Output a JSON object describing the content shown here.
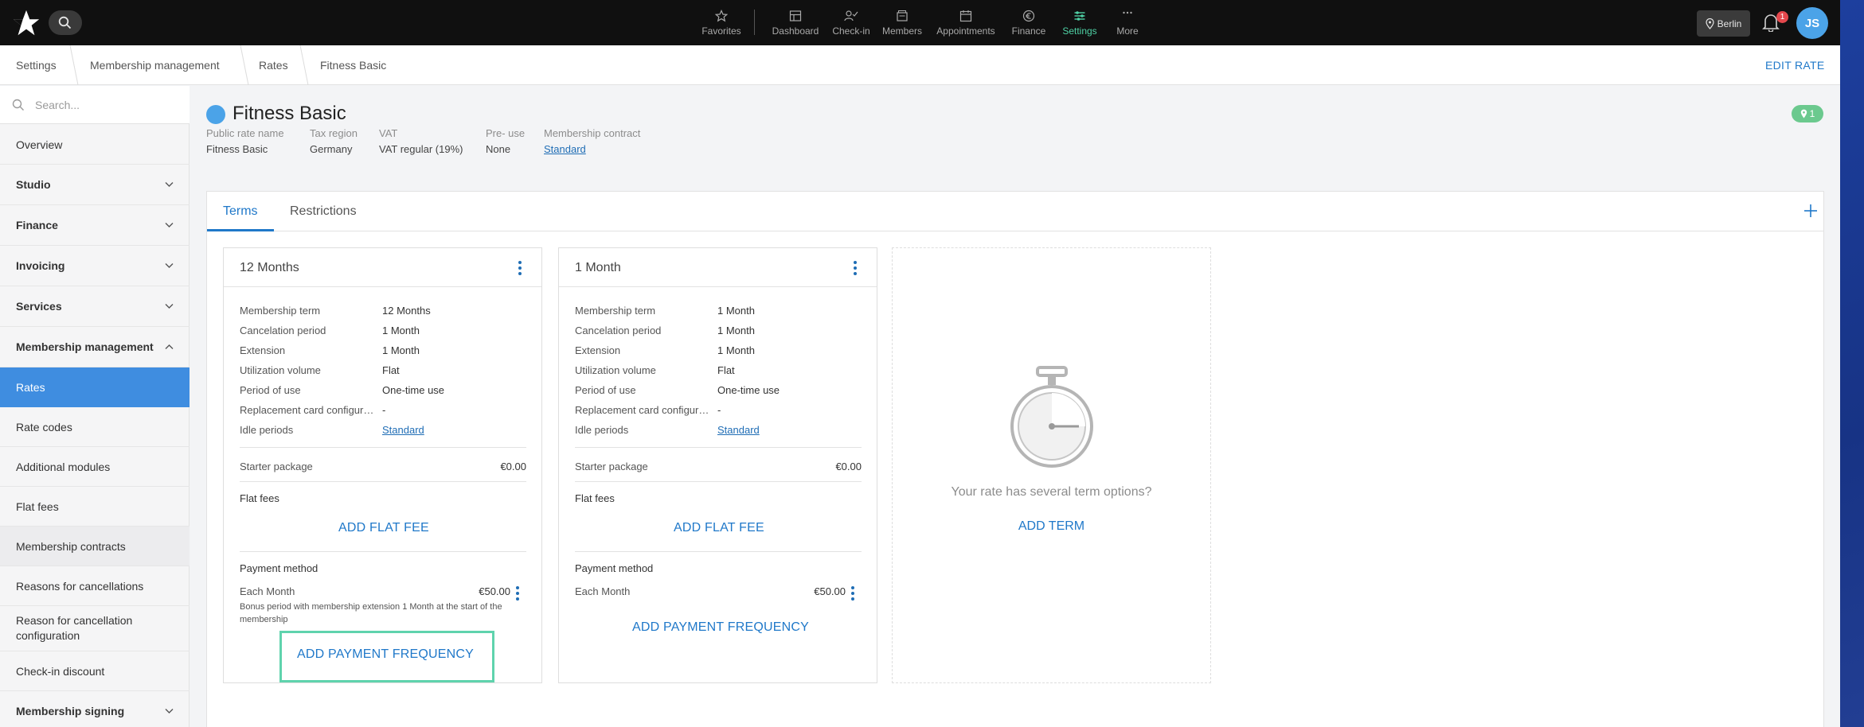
{
  "topbar": {
    "nav": [
      {
        "label": "Favorites",
        "icon": "star-icon"
      },
      {
        "label": "Dashboard",
        "icon": "dashboard-icon"
      },
      {
        "label": "Check-in",
        "icon": "check-in-icon"
      },
      {
        "label": "Members",
        "icon": "members-icon"
      },
      {
        "label": "Appointments",
        "icon": "calendar-icon"
      },
      {
        "label": "Finance",
        "icon": "euro-icon"
      },
      {
        "label": "Settings",
        "icon": "settings-icon",
        "active": true
      },
      {
        "label": "More",
        "icon": "more-icon"
      }
    ],
    "location": "Berlin",
    "notification_count": "1",
    "avatar_initials": "JS",
    "accent": "#4fd1a5"
  },
  "breadcrumb": [
    "Settings",
    "Membership management",
    "Rates",
    "Fitness Basic"
  ],
  "edit_rate": "EDIT RATE",
  "sidebar": {
    "search_placeholder": "Search...",
    "items": [
      {
        "label": "Overview"
      },
      {
        "label": "Studio",
        "section": true
      },
      {
        "label": "Finance",
        "section": true
      },
      {
        "label": "Invoicing",
        "section": true
      },
      {
        "label": "Services",
        "section": true
      },
      {
        "label": "Membership management",
        "section": true,
        "expanded": true
      },
      {
        "label": "Rates",
        "active": true
      },
      {
        "label": "Rate codes"
      },
      {
        "label": "Additional modules"
      },
      {
        "label": "Flat fees"
      },
      {
        "label": "Membership contracts"
      },
      {
        "label": "Reasons for cancellations"
      },
      {
        "label": "Reason for cancellation configuration"
      },
      {
        "label": "Check-in discount"
      },
      {
        "label": "Membership signing",
        "section": true
      }
    ]
  },
  "rate": {
    "title": "Fitness Basic",
    "color": "#4ba3e8",
    "badge_count": "1",
    "meta": [
      {
        "label": "Public rate name",
        "value": "Fitness Basic"
      },
      {
        "label": "Tax region",
        "value": "Germany"
      },
      {
        "label": "VAT",
        "value": "VAT regular (19%)"
      },
      {
        "label": "Pre- use",
        "value": "None"
      },
      {
        "label": "Membership contract",
        "value": "Standard",
        "link": true
      }
    ]
  },
  "tabs": [
    "Terms",
    "Restrictions"
  ],
  "labels": {
    "membership_term": "Membership term",
    "cancelation_period": "Cancelation period",
    "extension": "Extension",
    "utilization_volume": "Utilization volume",
    "period_of_use": "Period of use",
    "replacement_card": "Replacement card configuration",
    "idle_periods": "Idle periods",
    "starter_package": "Starter package",
    "flat_fees": "Flat fees",
    "add_flat_fee": "ADD FLAT FEE",
    "payment_method": "Payment method",
    "add_payment_frequency": "ADD PAYMENT FREQUENCY"
  },
  "terms": [
    {
      "title": "12 Months",
      "membership_term": "12 Months",
      "cancelation_period": "1 Month",
      "extension": "1 Month",
      "utilization_volume": "Flat",
      "period_of_use": "One-time use",
      "replacement_card": "-",
      "idle_periods": "Standard",
      "starter_package": "€0.00",
      "payment_frequency": "Each Month",
      "payment_amount": "€50.00",
      "payment_note": "Bonus period with membership extension 1 Month at the start of the membership"
    },
    {
      "title": "1 Month",
      "membership_term": "1 Month",
      "cancelation_period": "1 Month",
      "extension": "1 Month",
      "utilization_volume": "Flat",
      "period_of_use": "One-time use",
      "replacement_card": "-",
      "idle_periods": "Standard",
      "starter_package": "€0.00",
      "payment_frequency": "Each Month",
      "payment_amount": "€50.00",
      "payment_note": ""
    }
  ],
  "empty_state": {
    "text": "Your rate has several term options?",
    "action": "ADD TERM",
    "icon": "stopwatch-icon"
  }
}
